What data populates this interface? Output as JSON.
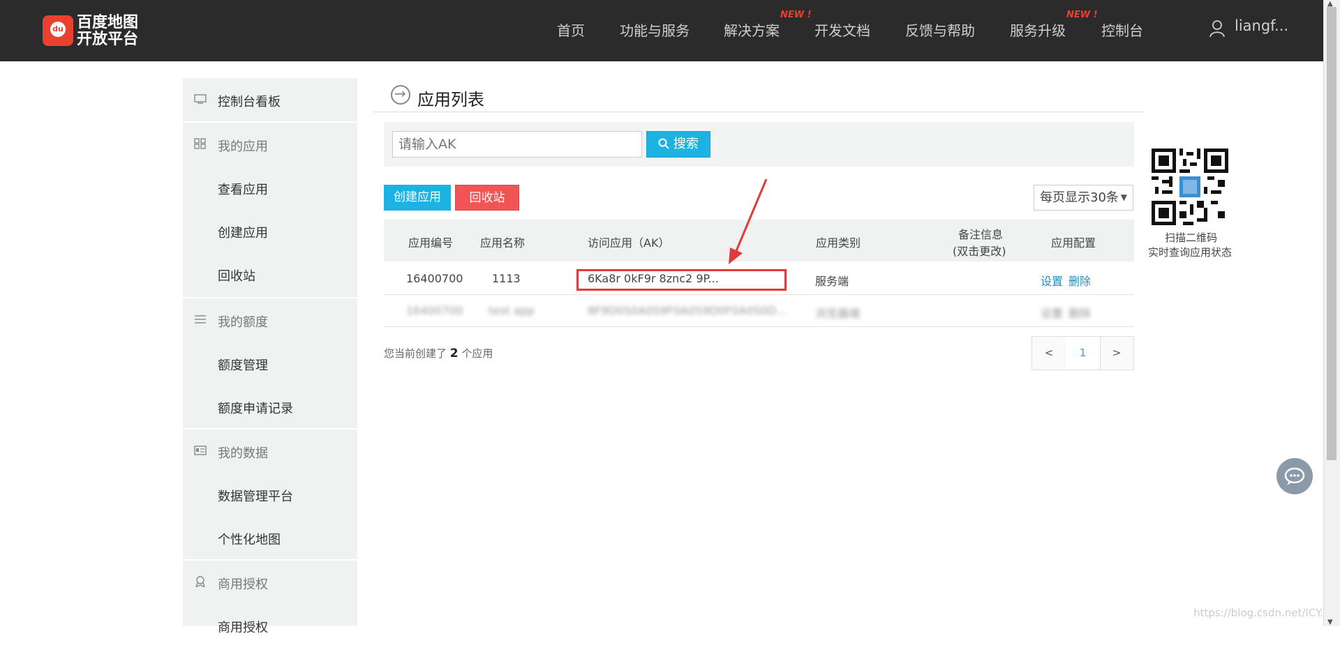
{
  "topbar": {
    "logo_badge": "du",
    "logo_line1": "百度地图",
    "logo_line2": "开放平台",
    "nav": [
      "首页",
      "功能与服务",
      "解决方案",
      "开发文档",
      "反馈与帮助",
      "服务升级",
      "控制台"
    ],
    "new_badge": "NEW !",
    "username": "liangf..."
  },
  "sidebar": {
    "items": [
      {
        "label": "控制台看板",
        "icon": "monitor-icon",
        "group": true
      },
      {
        "label": "我的应用",
        "icon": "grid-icon",
        "group": true
      },
      {
        "label": "查看应用",
        "icon": "",
        "group": false
      },
      {
        "label": "创建应用",
        "icon": "",
        "group": false
      },
      {
        "label": "回收站",
        "icon": "",
        "group": false
      },
      {
        "label": "我的额度",
        "icon": "sliders-icon",
        "group": true
      },
      {
        "label": "额度管理",
        "icon": "",
        "group": false
      },
      {
        "label": "额度申请记录",
        "icon": "",
        "group": false
      },
      {
        "label": "我的数据",
        "icon": "id-card-icon",
        "group": true
      },
      {
        "label": "数据管理平台",
        "icon": "",
        "group": false
      },
      {
        "label": "个性化地图",
        "icon": "",
        "group": false
      },
      {
        "label": "商用授权",
        "icon": "badge-icon",
        "group": true
      },
      {
        "label": "商用授权",
        "icon": "",
        "group": false
      }
    ]
  },
  "main": {
    "title": "应用列表",
    "search_placeholder": "请输入AK",
    "search_button": "搜索",
    "create_button": "创建应用",
    "recycle_button": "回收站",
    "per_page": "每页显示30条",
    "columns": [
      "应用编号",
      "应用名称",
      "访问应用（AK）",
      "应用类别",
      "备注信息",
      "(双击更改)",
      "应用配置"
    ],
    "rows": [
      {
        "id": "16400700",
        "name": "1113",
        "ak": "6Ka8r 0kF9r 8znc2 9P...",
        "type": "服务端",
        "note": "",
        "action1": "设置",
        "action2": "删除"
      },
      {
        "id": "16400700",
        "name": "test app",
        "ak": "8F9D0S0A0S9F0A0S9D0F0A0S0D...",
        "type": "浏览器端",
        "note": "",
        "action1": "设置",
        "action2": "删除"
      }
    ],
    "count_prefix": "您当前创建了",
    "count_value": "2",
    "count_suffix": "个应用",
    "pager": {
      "prev": "<",
      "current": "1",
      "next": ">"
    }
  },
  "qr": {
    "caption1": "扫描二维码",
    "caption2": "实时查询应用状态"
  },
  "watermark": "https://blog.csdn.net/ICY..."
}
